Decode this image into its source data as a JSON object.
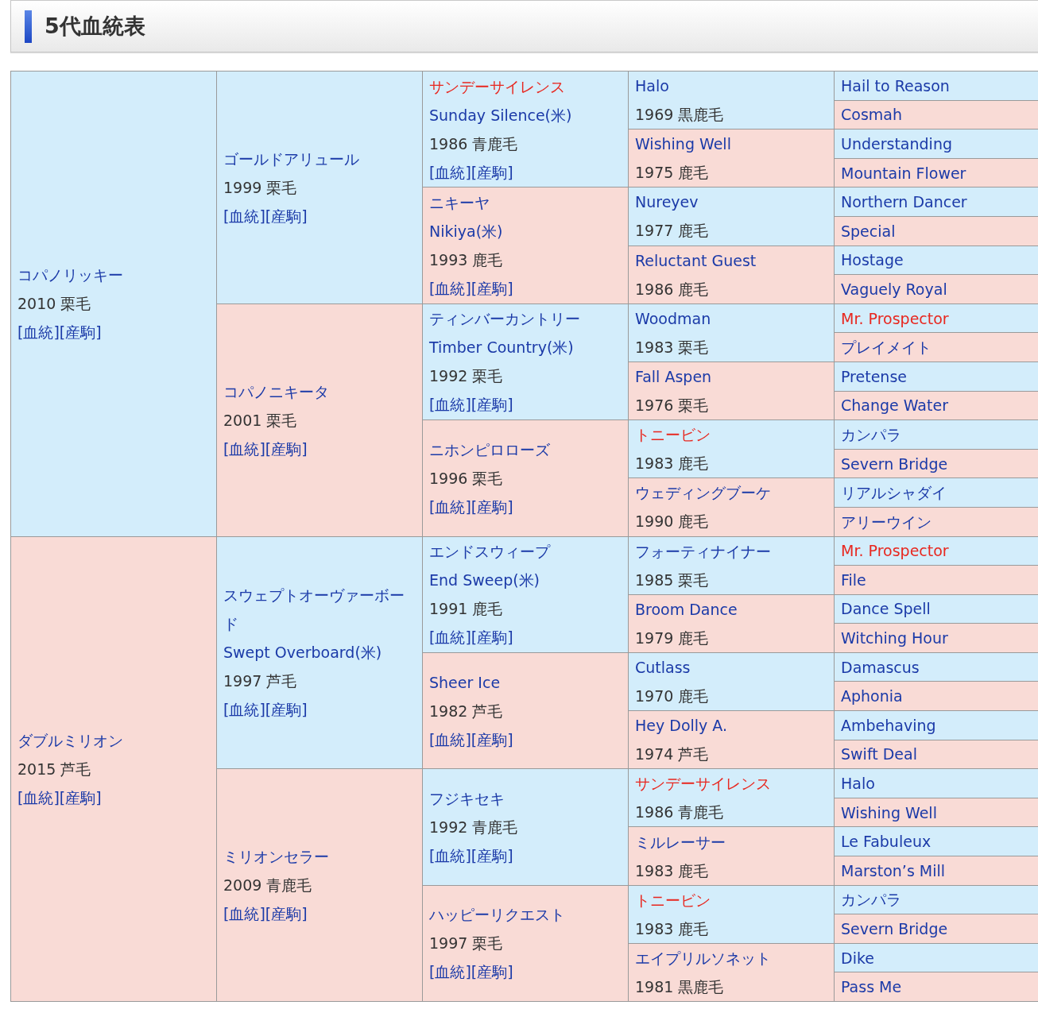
{
  "title": "5代血統表",
  "pedigree": [
    {
      "name": "コパノリッキー",
      "year_coat": "2010 栗毛",
      "links": [
        "[血統]",
        "[産駒]"
      ],
      "female": false,
      "inbred": false,
      "parents": [
        {
          "name": "ゴールドアリュール",
          "year_coat": "1999 栗毛",
          "links": [
            "[血統]",
            "[産駒]"
          ],
          "female": false,
          "inbred": false,
          "parents": [
            {
              "name": "サンデーサイレンス",
              "foreign_name": "Sunday Silence(米)",
              "year_coat": "1986 青鹿毛",
              "links": [
                "[血統]",
                "[産駒]"
              ],
              "female": false,
              "inbred": true,
              "parents": [
                {
                  "name": "Halo",
                  "year_coat": "1969 黒鹿毛",
                  "female": false,
                  "inbred": false,
                  "parents": [
                    {
                      "name": "Hail to Reason",
                      "female": false,
                      "inbred": false
                    },
                    {
                      "name": "Cosmah",
                      "female": true,
                      "inbred": false
                    }
                  ]
                },
                {
                  "name": "Wishing Well",
                  "year_coat": "1975 鹿毛",
                  "female": true,
                  "inbred": false,
                  "parents": [
                    {
                      "name": "Understanding",
                      "female": false,
                      "inbred": false
                    },
                    {
                      "name": "Mountain Flower",
                      "female": true,
                      "inbred": false
                    }
                  ]
                }
              ]
            },
            {
              "name": "ニキーヤ",
              "foreign_name": "Nikiya(米)",
              "year_coat": "1993 鹿毛",
              "links": [
                "[血統]",
                "[産駒]"
              ],
              "female": true,
              "inbred": false,
              "parents": [
                {
                  "name": "Nureyev",
                  "year_coat": "1977 鹿毛",
                  "female": false,
                  "inbred": false,
                  "parents": [
                    {
                      "name": "Northern Dancer",
                      "female": false,
                      "inbred": false
                    },
                    {
                      "name": "Special",
                      "female": true,
                      "inbred": false
                    }
                  ]
                },
                {
                  "name": "Reluctant Guest",
                  "year_coat": "1986 鹿毛",
                  "female": true,
                  "inbred": false,
                  "parents": [
                    {
                      "name": "Hostage",
                      "female": false,
                      "inbred": false
                    },
                    {
                      "name": "Vaguely Royal",
                      "female": true,
                      "inbred": false
                    }
                  ]
                }
              ]
            }
          ]
        },
        {
          "name": "コパノニキータ",
          "year_coat": "2001 栗毛",
          "links": [
            "[血統]",
            "[産駒]"
          ],
          "female": true,
          "inbred": false,
          "parents": [
            {
              "name": "ティンバーカントリー",
              "foreign_name": "Timber Country(米)",
              "year_coat": "1992 栗毛",
              "links": [
                "[血統]",
                "[産駒]"
              ],
              "female": false,
              "inbred": false,
              "parents": [
                {
                  "name": "Woodman",
                  "year_coat": "1983 栗毛",
                  "female": false,
                  "inbred": false,
                  "parents": [
                    {
                      "name": "Mr. Prospector",
                      "female": false,
                      "inbred": true
                    },
                    {
                      "name": "プレイメイト",
                      "female": true,
                      "inbred": false
                    }
                  ]
                },
                {
                  "name": "Fall Aspen",
                  "year_coat": "1976 栗毛",
                  "female": true,
                  "inbred": false,
                  "parents": [
                    {
                      "name": "Pretense",
                      "female": false,
                      "inbred": false
                    },
                    {
                      "name": "Change Water",
                      "female": true,
                      "inbred": false
                    }
                  ]
                }
              ]
            },
            {
              "name": "ニホンピロローズ",
              "year_coat": "1996 栗毛",
              "links": [
                "[血統]",
                "[産駒]"
              ],
              "female": true,
              "inbred": false,
              "parents": [
                {
                  "name": "トニービン",
                  "year_coat": "1983 鹿毛",
                  "female": false,
                  "inbred": true,
                  "parents": [
                    {
                      "name": "カンパラ",
                      "female": false,
                      "inbred": false
                    },
                    {
                      "name": "Severn Bridge",
                      "female": true,
                      "inbred": false
                    }
                  ]
                },
                {
                  "name": "ウェディングブーケ",
                  "year_coat": "1990 鹿毛",
                  "female": true,
                  "inbred": false,
                  "parents": [
                    {
                      "name": "リアルシャダイ",
                      "female": false,
                      "inbred": false
                    },
                    {
                      "name": "アリーウイン",
                      "female": true,
                      "inbred": false
                    }
                  ]
                }
              ]
            }
          ]
        }
      ]
    },
    {
      "name": "ダブルミリオン",
      "year_coat": "2015 芦毛",
      "links": [
        "[血統]",
        "[産駒]"
      ],
      "female": true,
      "inbred": false,
      "parents": [
        {
          "name": "スウェプトオーヴァーボード",
          "foreign_name": "Swept Overboard(米)",
          "year_coat": "1997 芦毛",
          "links": [
            "[血統]",
            "[産駒]"
          ],
          "female": false,
          "inbred": false,
          "parents": [
            {
              "name": "エンドスウィープ",
              "foreign_name": "End Sweep(米)",
              "year_coat": "1991 鹿毛",
              "links": [
                "[血統]",
                "[産駒]"
              ],
              "female": false,
              "inbred": false,
              "parents": [
                {
                  "name": "フォーティナイナー",
                  "year_coat": "1985 栗毛",
                  "female": false,
                  "inbred": false,
                  "parents": [
                    {
                      "name": "Mr. Prospector",
                      "female": false,
                      "inbred": true
                    },
                    {
                      "name": "File",
                      "female": true,
                      "inbred": false
                    }
                  ]
                },
                {
                  "name": "Broom Dance",
                  "year_coat": "1979 鹿毛",
                  "female": true,
                  "inbred": false,
                  "parents": [
                    {
                      "name": "Dance Spell",
                      "female": false,
                      "inbred": false
                    },
                    {
                      "name": "Witching Hour",
                      "female": true,
                      "inbred": false
                    }
                  ]
                }
              ]
            },
            {
              "name": "Sheer Ice",
              "year_coat": "1982 芦毛",
              "links": [
                "[血統]",
                "[産駒]"
              ],
              "female": true,
              "inbred": false,
              "parents": [
                {
                  "name": "Cutlass",
                  "year_coat": "1970 鹿毛",
                  "female": false,
                  "inbred": false,
                  "parents": [
                    {
                      "name": "Damascus",
                      "female": false,
                      "inbred": false
                    },
                    {
                      "name": "Aphonia",
                      "female": true,
                      "inbred": false
                    }
                  ]
                },
                {
                  "name": "Hey Dolly A.",
                  "year_coat": "1974 芦毛",
                  "female": true,
                  "inbred": false,
                  "parents": [
                    {
                      "name": "Ambehaving",
                      "female": false,
                      "inbred": false
                    },
                    {
                      "name": "Swift Deal",
                      "female": true,
                      "inbred": false
                    }
                  ]
                }
              ]
            }
          ]
        },
        {
          "name": "ミリオンセラー",
          "year_coat": "2009 青鹿毛",
          "links": [
            "[血統]",
            "[産駒]"
          ],
          "female": true,
          "inbred": false,
          "parents": [
            {
              "name": "フジキセキ",
              "year_coat": "1992 青鹿毛",
              "links": [
                "[血統]",
                "[産駒]"
              ],
              "female": false,
              "inbred": false,
              "parents": [
                {
                  "name": "サンデーサイレンス",
                  "year_coat": "1986 青鹿毛",
                  "female": false,
                  "inbred": true,
                  "parents": [
                    {
                      "name": "Halo",
                      "female": false,
                      "inbred": false
                    },
                    {
                      "name": "Wishing Well",
                      "female": true,
                      "inbred": false
                    }
                  ]
                },
                {
                  "name": "ミルレーサー",
                  "year_coat": "1983 鹿毛",
                  "female": true,
                  "inbred": false,
                  "parents": [
                    {
                      "name": "Le Fabuleux",
                      "female": false,
                      "inbred": false
                    },
                    {
                      "name": "Marston’s Mill",
                      "female": true,
                      "inbred": false
                    }
                  ]
                }
              ]
            },
            {
              "name": "ハッピーリクエスト",
              "year_coat": "1997 栗毛",
              "links": [
                "[血統]",
                "[産駒]"
              ],
              "female": true,
              "inbred": false,
              "parents": [
                {
                  "name": "トニービン",
                  "year_coat": "1983 鹿毛",
                  "female": false,
                  "inbred": true,
                  "parents": [
                    {
                      "name": "カンパラ",
                      "female": false,
                      "inbred": false
                    },
                    {
                      "name": "Severn Bridge",
                      "female": true,
                      "inbred": false
                    }
                  ]
                },
                {
                  "name": "エイプリルソネット",
                  "year_coat": "1981 黒鹿毛",
                  "female": true,
                  "inbred": false,
                  "parents": [
                    {
                      "name": "Dike",
                      "female": false,
                      "inbred": false
                    },
                    {
                      "name": "Pass Me",
                      "female": true,
                      "inbred": false
                    }
                  ]
                }
              ]
            }
          ]
        }
      ]
    }
  ]
}
